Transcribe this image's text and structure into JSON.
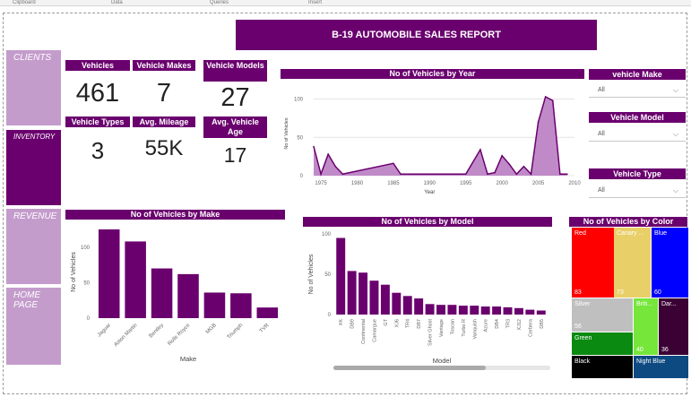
{
  "ribbon": [
    "Clipboard",
    "Data",
    "Queries",
    "Insert"
  ],
  "report_title": "B-19 AUTOMOBILE SALES REPORT",
  "nav": [
    {
      "label": "CLIENTS"
    },
    {
      "label": "INVENTORY"
    },
    {
      "label": "REVENUE"
    },
    {
      "label": "HOME PAGE"
    }
  ],
  "kpis": {
    "vehicles": {
      "label": "Vehicles",
      "value": "461"
    },
    "makes": {
      "label": "Vehicle Makes",
      "value": "7"
    },
    "models": {
      "label": "Vehicle Models",
      "value": "27"
    },
    "types": {
      "label": "Vehicle Types",
      "value": "3"
    },
    "mileage": {
      "label": "Avg. Mileage",
      "value": "55K"
    },
    "age": {
      "label": "Avg. Vehicle Age",
      "value": "17"
    }
  },
  "slicers": [
    {
      "title": "vehicle Make",
      "value": "All"
    },
    {
      "title": "Vehicle Model",
      "value": "All"
    },
    {
      "title": "Vehicle Type",
      "value": "All"
    }
  ],
  "colors": {
    "accent": "#6a006e",
    "accent_light": "#c49ccc",
    "area_fill": "#c08ac8"
  },
  "chart_data": [
    {
      "type": "area",
      "title": "No of Vehicles by Year",
      "xlabel": "Year",
      "ylabel": "No of Vehicles",
      "xlim": [
        1974,
        2010
      ],
      "ylim": [
        0,
        110
      ],
      "xticks": [
        "1975",
        "1980",
        "1985",
        "1990",
        "1995",
        "2000",
        "2005",
        "2010"
      ],
      "yticks": [
        "0",
        "50",
        "100"
      ],
      "x": [
        1974,
        1975,
        1976,
        1977,
        1978,
        1985,
        1986,
        1995,
        1997,
        1998,
        1999,
        2000,
        2001,
        2002,
        2003,
        2004,
        2005,
        2006,
        2007,
        2008,
        2009
      ],
      "values": [
        38,
        2,
        28,
        12,
        2,
        16,
        2,
        2,
        34,
        2,
        4,
        26,
        15,
        2,
        12,
        2,
        70,
        103,
        98,
        2,
        2
      ]
    },
    {
      "type": "bar",
      "title": "No of Vehicles by Make",
      "xlabel": "Make",
      "ylabel": "No of Vehicles",
      "ylim": [
        0,
        130
      ],
      "yticks": [
        "0",
        "50",
        "100"
      ],
      "categories": [
        "Jaguar",
        "Aston Martin",
        "Bentley",
        "Rolls Royce",
        "MGB",
        "Triumph",
        "TVR"
      ],
      "values": [
        125,
        108,
        70,
        62,
        36,
        35,
        15
      ]
    },
    {
      "type": "bar",
      "title": "No of Vehicles by Model",
      "xlabel": "Model",
      "ylabel": "No of Vehicles",
      "ylim": [
        0,
        100
      ],
      "yticks": [
        "0",
        "50",
        "100"
      ],
      "categories": [
        "XK",
        "DB9",
        "Continental",
        "Camargue",
        "GT",
        "XJ6",
        "TR4",
        "DB7",
        "Silver Ghost",
        "Vantage",
        "Toscan",
        "Turbo R",
        "Vanquish",
        "Azure",
        "DB4",
        "TR3",
        "XJ12",
        "Cerbera",
        "DB5"
      ],
      "values": [
        95,
        54,
        52,
        42,
        37,
        27,
        23,
        20,
        13,
        12,
        12,
        11,
        11,
        10,
        10,
        9,
        8,
        6,
        5
      ]
    },
    {
      "type": "heatmap",
      "title": "No of Vehicles by Color",
      "categories": [
        "Red",
        "Canary Yellow",
        "Blue",
        "Silver",
        "British Racing Green",
        "Dark Purple",
        "Green",
        "Black",
        "Night Blue"
      ],
      "values": [
        83,
        73,
        60,
        56,
        40,
        36,
        35,
        30,
        29
      ],
      "labels": [
        {
          "name": "Red",
          "count": "83"
        },
        {
          "name": "Canary ...",
          "count": "73"
        },
        {
          "name": "Blue",
          "count": "60"
        },
        {
          "name": "Silver",
          "count": "56"
        },
        {
          "name": "Briti...",
          "count": "40"
        },
        {
          "name": "Dar...",
          "count": "36"
        },
        {
          "name": "Green",
          "count": ""
        },
        {
          "name": "Black",
          "count": ""
        },
        {
          "name": "Night Blue",
          "count": ""
        }
      ],
      "fills": [
        "#ff0000",
        "#e8cf68",
        "#0000ff",
        "#bfbfbf",
        "#76e63b",
        "#3b0034",
        "#0a8a10",
        "#000000",
        "#0e4a82"
      ]
    }
  ]
}
